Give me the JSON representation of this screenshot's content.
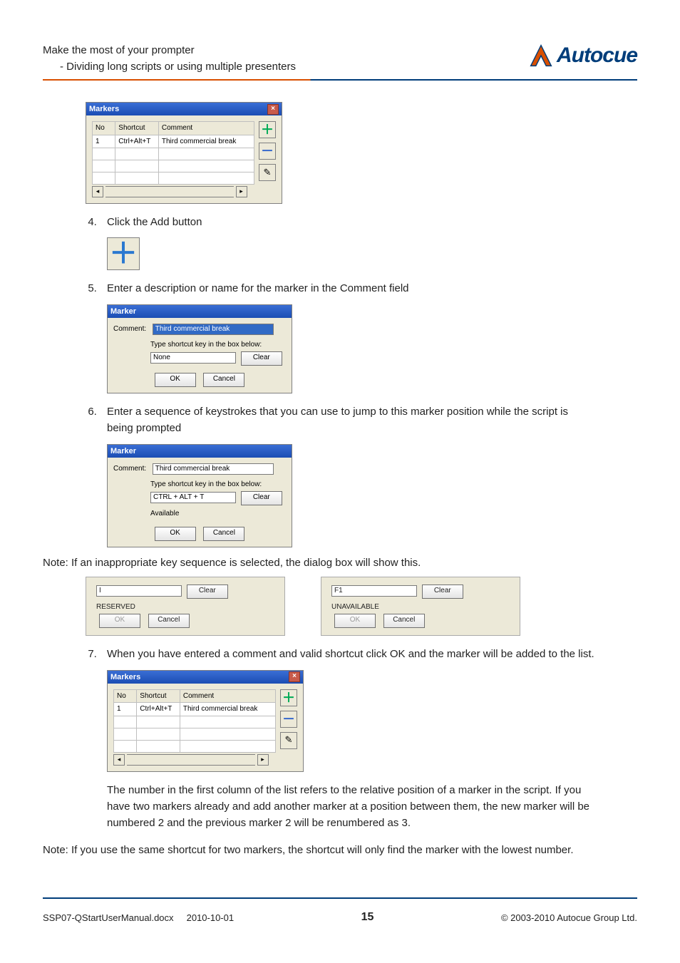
{
  "header": {
    "line1": "Make the most of your prompter",
    "line2": "- Dividing long scripts or using multiple presenters",
    "brand": "Autocue"
  },
  "markers_dialog": {
    "title": "Markers",
    "cols": {
      "no": "No",
      "shortcut": "Shortcut",
      "comment": "Comment"
    },
    "row": {
      "no": "1",
      "shortcut": "Ctrl+Alt+T",
      "comment": "Third commercial break"
    }
  },
  "steps": {
    "s4": "Click the Add button",
    "s5": "Enter a description or name for the marker in the Comment field",
    "s6": "Enter a sequence of keystrokes that you can use to jump to this marker position while the script is being prompted",
    "s7": "When you have entered a comment and valid shortcut click OK and the marker will be added to the list."
  },
  "marker_dialog": {
    "title": "Marker",
    "comment_label": "Comment:",
    "comment_value": "Third commercial break",
    "type_hint": "Type shortcut key in the box below:",
    "none": "None",
    "ctrl_alt_t": "CTRL + ALT + T",
    "available": "Available",
    "clear": "Clear",
    "ok": "OK",
    "cancel": "Cancel"
  },
  "note1": "Note: If an inappropriate key sequence is selected, the dialog box will show this.",
  "reserved_panel": {
    "value": "I",
    "status": "RESERVED"
  },
  "unavail_panel": {
    "value": "F1",
    "status": "UNAVAILABLE"
  },
  "para_after7": "The number in the first column of the list refers to the relative position of a marker in the script. If you have two markers already and add another marker at a position between them, the new marker will be numbered 2 and the previous marker 2 will be renumbered as 3.",
  "note2": "Note: If you use the same shortcut for two markers, the shortcut will only find the marker with the lowest number.",
  "footer": {
    "doc": "SSP07-QStartUserManual.docx",
    "date": "2010-10-01",
    "page": "15",
    "copyright": "© 2003-2010 Autocue Group Ltd."
  }
}
